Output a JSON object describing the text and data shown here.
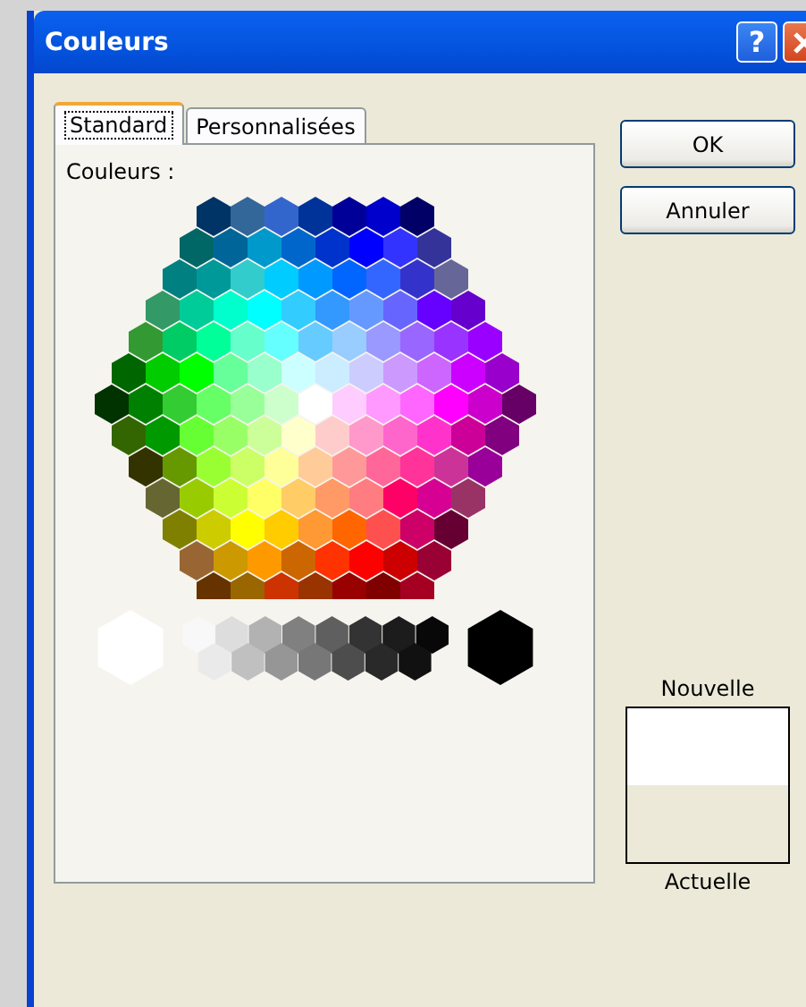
{
  "window": {
    "title": "Couleurs",
    "help_button": "?"
  },
  "tabs": [
    {
      "label": "Standard",
      "selected": true
    },
    {
      "label": "Personnalisées",
      "selected": false
    }
  ],
  "palette_label": "Couleurs :",
  "palette": {
    "rows": [
      [
        {
          "color": "#003366"
        },
        {
          "color": "#336699"
        },
        {
          "color": "#3366cc"
        },
        {
          "color": "#003399"
        },
        {
          "color": "#000099"
        },
        {
          "color": "#0000cc"
        },
        {
          "color": "#000066"
        }
      ],
      [
        {
          "color": "#006666"
        },
        {
          "color": "#006699"
        },
        {
          "color": "#0099cc"
        },
        {
          "color": "#0066cc"
        },
        {
          "color": "#0033cc"
        },
        {
          "color": "#0000ff"
        },
        {
          "color": "#3333ff"
        },
        {
          "color": "#333399"
        }
      ],
      [
        {
          "color": "#008080"
        },
        {
          "color": "#009999"
        },
        {
          "color": "#33cccc"
        },
        {
          "color": "#00ccff"
        },
        {
          "color": "#0099ff"
        },
        {
          "color": "#0066ff"
        },
        {
          "color": "#3366ff"
        },
        {
          "color": "#3333cc"
        },
        {
          "color": "#666699"
        }
      ],
      [
        {
          "color": "#339966"
        },
        {
          "color": "#00cc99"
        },
        {
          "color": "#00ffcc"
        },
        {
          "color": "#00ffff"
        },
        {
          "color": "#33ccff"
        },
        {
          "color": "#3399ff"
        },
        {
          "color": "#6699ff"
        },
        {
          "color": "#6666ff"
        },
        {
          "color": "#6600ff"
        },
        {
          "color": "#6600cc"
        }
      ],
      [
        {
          "color": "#339933"
        },
        {
          "color": "#00cc66"
        },
        {
          "color": "#00ff99"
        },
        {
          "color": "#66ffcc"
        },
        {
          "color": "#66ffff"
        },
        {
          "color": "#66ccff"
        },
        {
          "color": "#99ccff"
        },
        {
          "color": "#9999ff"
        },
        {
          "color": "#9966ff"
        },
        {
          "color": "#9933ff"
        },
        {
          "color": "#9900ff"
        }
      ],
      [
        {
          "color": "#006600"
        },
        {
          "color": "#00cc00"
        },
        {
          "color": "#00ff00"
        },
        {
          "color": "#66ff99"
        },
        {
          "color": "#99ffcc"
        },
        {
          "color": "#ccffff"
        },
        {
          "color": "#ccecff"
        },
        {
          "color": "#ccccff"
        },
        {
          "color": "#cc99ff"
        },
        {
          "color": "#cc66ff"
        },
        {
          "color": "#cc00ff"
        },
        {
          "color": "#9900cc"
        }
      ],
      [
        {
          "color": "#003300"
        },
        {
          "color": "#008000"
        },
        {
          "color": "#33cc33"
        },
        {
          "color": "#66ff66"
        },
        {
          "color": "#99ff99"
        },
        {
          "color": "#ccffcc"
        },
        {
          "color": "#ffffff"
        },
        {
          "color": "#ffccff"
        },
        {
          "color": "#ff99ff"
        },
        {
          "color": "#ff66ff"
        },
        {
          "color": "#ff00ff"
        },
        {
          "color": "#cc00cc"
        },
        {
          "color": "#660066"
        }
      ],
      [
        {
          "color": "#336600"
        },
        {
          "color": "#009900"
        },
        {
          "color": "#66ff33"
        },
        {
          "color": "#99ff66"
        },
        {
          "color": "#ccff99"
        },
        {
          "color": "#ffffcc"
        },
        {
          "color": "#ffcccc"
        },
        {
          "color": "#ff99cc"
        },
        {
          "color": "#ff66cc"
        },
        {
          "color": "#ff33cc"
        },
        {
          "color": "#cc0099"
        },
        {
          "color": "#800080"
        }
      ],
      [
        {
          "color": "#333300"
        },
        {
          "color": "#669900"
        },
        {
          "color": "#99ff33"
        },
        {
          "color": "#ccff66"
        },
        {
          "color": "#ffff99"
        },
        {
          "color": "#ffcc99"
        },
        {
          "color": "#ff9999"
        },
        {
          "color": "#ff6699"
        },
        {
          "color": "#ff3399"
        },
        {
          "color": "#cc3399"
        },
        {
          "color": "#990099"
        }
      ],
      [
        {
          "color": "#666633"
        },
        {
          "color": "#99cc00"
        },
        {
          "color": "#ccff33"
        },
        {
          "color": "#ffff66"
        },
        {
          "color": "#ffcc66"
        },
        {
          "color": "#ff9966"
        },
        {
          "color": "#ff7c80"
        },
        {
          "color": "#ff0066"
        },
        {
          "color": "#d60093"
        },
        {
          "color": "#993366"
        }
      ],
      [
        {
          "color": "#808000"
        },
        {
          "color": "#cccc00"
        },
        {
          "color": "#ffff00"
        },
        {
          "color": "#ffcc00"
        },
        {
          "color": "#ff9933"
        },
        {
          "color": "#ff6600"
        },
        {
          "color": "#ff5050"
        },
        {
          "color": "#cc0066"
        },
        {
          "color": "#660033"
        }
      ],
      [
        {
          "color": "#996633"
        },
        {
          "color": "#cc9900"
        },
        {
          "color": "#ff9900"
        },
        {
          "color": "#cc6600"
        },
        {
          "color": "#ff3300"
        },
        {
          "color": "#ff0000"
        },
        {
          "color": "#cc0000"
        },
        {
          "color": "#990033"
        }
      ],
      [
        {
          "color": "#663300"
        },
        {
          "color": "#996600"
        },
        {
          "color": "#cc3300"
        },
        {
          "color": "#993300"
        },
        {
          "color": "#990000"
        },
        {
          "color": "#800000"
        },
        {
          "color": "#a50021"
        }
      ]
    ]
  },
  "grays": {
    "white_swatch": {
      "color": "#ffffff"
    },
    "top_row": [
      {
        "color": "#f8f8f8"
      },
      {
        "color": "#dddddd"
      },
      {
        "color": "#b2b2b2"
      },
      {
        "color": "#808080"
      },
      {
        "color": "#5f5f5f"
      },
      {
        "color": "#333333"
      },
      {
        "color": "#1c1c1c"
      },
      {
        "color": "#080808"
      }
    ],
    "bottom_row": [
      {
        "color": "#eaeaea"
      },
      {
        "color": "#c0c0c0"
      },
      {
        "color": "#969696"
      },
      {
        "color": "#777777"
      },
      {
        "color": "#4d4d4d"
      },
      {
        "color": "#292929"
      },
      {
        "color": "#111111"
      }
    ],
    "black_swatch": {
      "color": "#000000"
    }
  },
  "buttons": [
    "OK",
    "Annuler"
  ],
  "preview": {
    "new_label": "Nouvelle",
    "samples": [
      {
        "color": "#ffffff"
      }
    ],
    "current_label": "Actuelle"
  }
}
